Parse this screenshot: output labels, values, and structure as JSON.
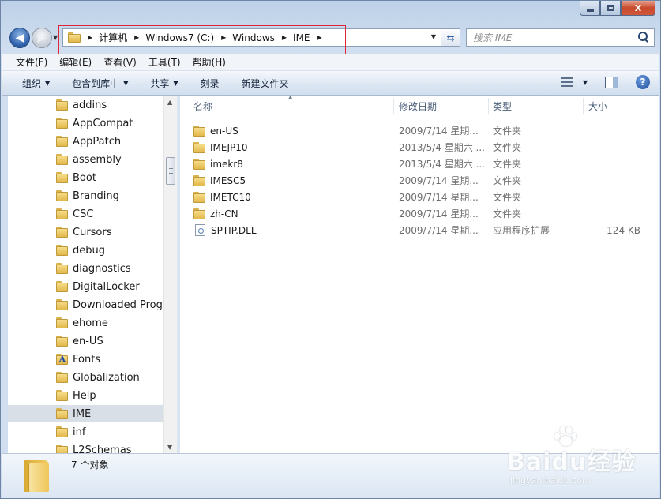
{
  "window": {
    "minimize_label": "",
    "maximize_label": "",
    "close_label": "X"
  },
  "navigation": {
    "back_glyph": "◀",
    "forward_glyph": "▶"
  },
  "address_bar": {
    "crumbs": [
      "计算机",
      "Windows7 (C:)",
      "Windows",
      "IME"
    ],
    "refresh_glyph": "⇆"
  },
  "search": {
    "placeholder": "搜索 IME"
  },
  "menu": {
    "items": [
      "文件(F)",
      "编辑(E)",
      "查看(V)",
      "工具(T)",
      "帮助(H)"
    ]
  },
  "toolbar": {
    "organize": "组织",
    "include_in_library": "包含到库中",
    "share": "共享",
    "burn": "刻录",
    "new_folder": "新建文件夹",
    "help_glyph": "?"
  },
  "sidebar": {
    "items": [
      {
        "label": "addins",
        "icon": "folder-icon"
      },
      {
        "label": "AppCompat",
        "icon": "folder-icon"
      },
      {
        "label": "AppPatch",
        "icon": "folder-icon"
      },
      {
        "label": "assembly",
        "icon": "folder-icon"
      },
      {
        "label": "Boot",
        "icon": "folder-icon"
      },
      {
        "label": "Branding",
        "icon": "folder-icon"
      },
      {
        "label": "CSC",
        "icon": "folder-icon"
      },
      {
        "label": "Cursors",
        "icon": "folder-icon"
      },
      {
        "label": "debug",
        "icon": "folder-icon"
      },
      {
        "label": "diagnostics",
        "icon": "folder-icon"
      },
      {
        "label": "DigitalLocker",
        "icon": "folder-icon"
      },
      {
        "label": "Downloaded Progra",
        "icon": "folder-icon"
      },
      {
        "label": "ehome",
        "icon": "folder-icon"
      },
      {
        "label": "en-US",
        "icon": "folder-icon"
      },
      {
        "label": "Fonts",
        "icon": "fonts-folder-icon"
      },
      {
        "label": "Globalization",
        "icon": "folder-icon"
      },
      {
        "label": "Help",
        "icon": "folder-icon"
      },
      {
        "label": "IME",
        "icon": "folder-icon",
        "selected": true
      },
      {
        "label": "inf",
        "icon": "folder-icon"
      },
      {
        "label": "L2Schemas",
        "icon": "folder-icon"
      }
    ]
  },
  "file_list": {
    "columns": {
      "name": "名称",
      "date": "修改日期",
      "type": "类型",
      "size": "大小"
    },
    "rows": [
      {
        "name": "en-US",
        "date": "2009/7/14 星期...",
        "type": "文件夹",
        "size": "",
        "icon": "folder-icon"
      },
      {
        "name": "IMEJP10",
        "date": "2013/5/4 星期六 ...",
        "type": "文件夹",
        "size": "",
        "icon": "folder-icon"
      },
      {
        "name": "imekr8",
        "date": "2013/5/4 星期六 ...",
        "type": "文件夹",
        "size": "",
        "icon": "folder-icon"
      },
      {
        "name": "IMESC5",
        "date": "2009/7/14 星期...",
        "type": "文件夹",
        "size": "",
        "icon": "folder-icon"
      },
      {
        "name": "IMETC10",
        "date": "2009/7/14 星期...",
        "type": "文件夹",
        "size": "",
        "icon": "folder-icon"
      },
      {
        "name": "zh-CN",
        "date": "2009/7/14 星期...",
        "type": "文件夹",
        "size": "",
        "icon": "folder-icon"
      },
      {
        "name": "SPTIP.DLL",
        "date": "2009/7/14 星期...",
        "type": "应用程序扩展",
        "size": "124 KB",
        "icon": "dll-file-icon"
      }
    ]
  },
  "status": {
    "item_count": "7 个对象"
  },
  "watermark": {
    "brand": "Baidu经验",
    "url": "jingyan.baidu.com"
  },
  "colors": {
    "annotation_box": "#e0263b",
    "selection": "#d9dfe7",
    "frame": "#bcd0e8"
  }
}
